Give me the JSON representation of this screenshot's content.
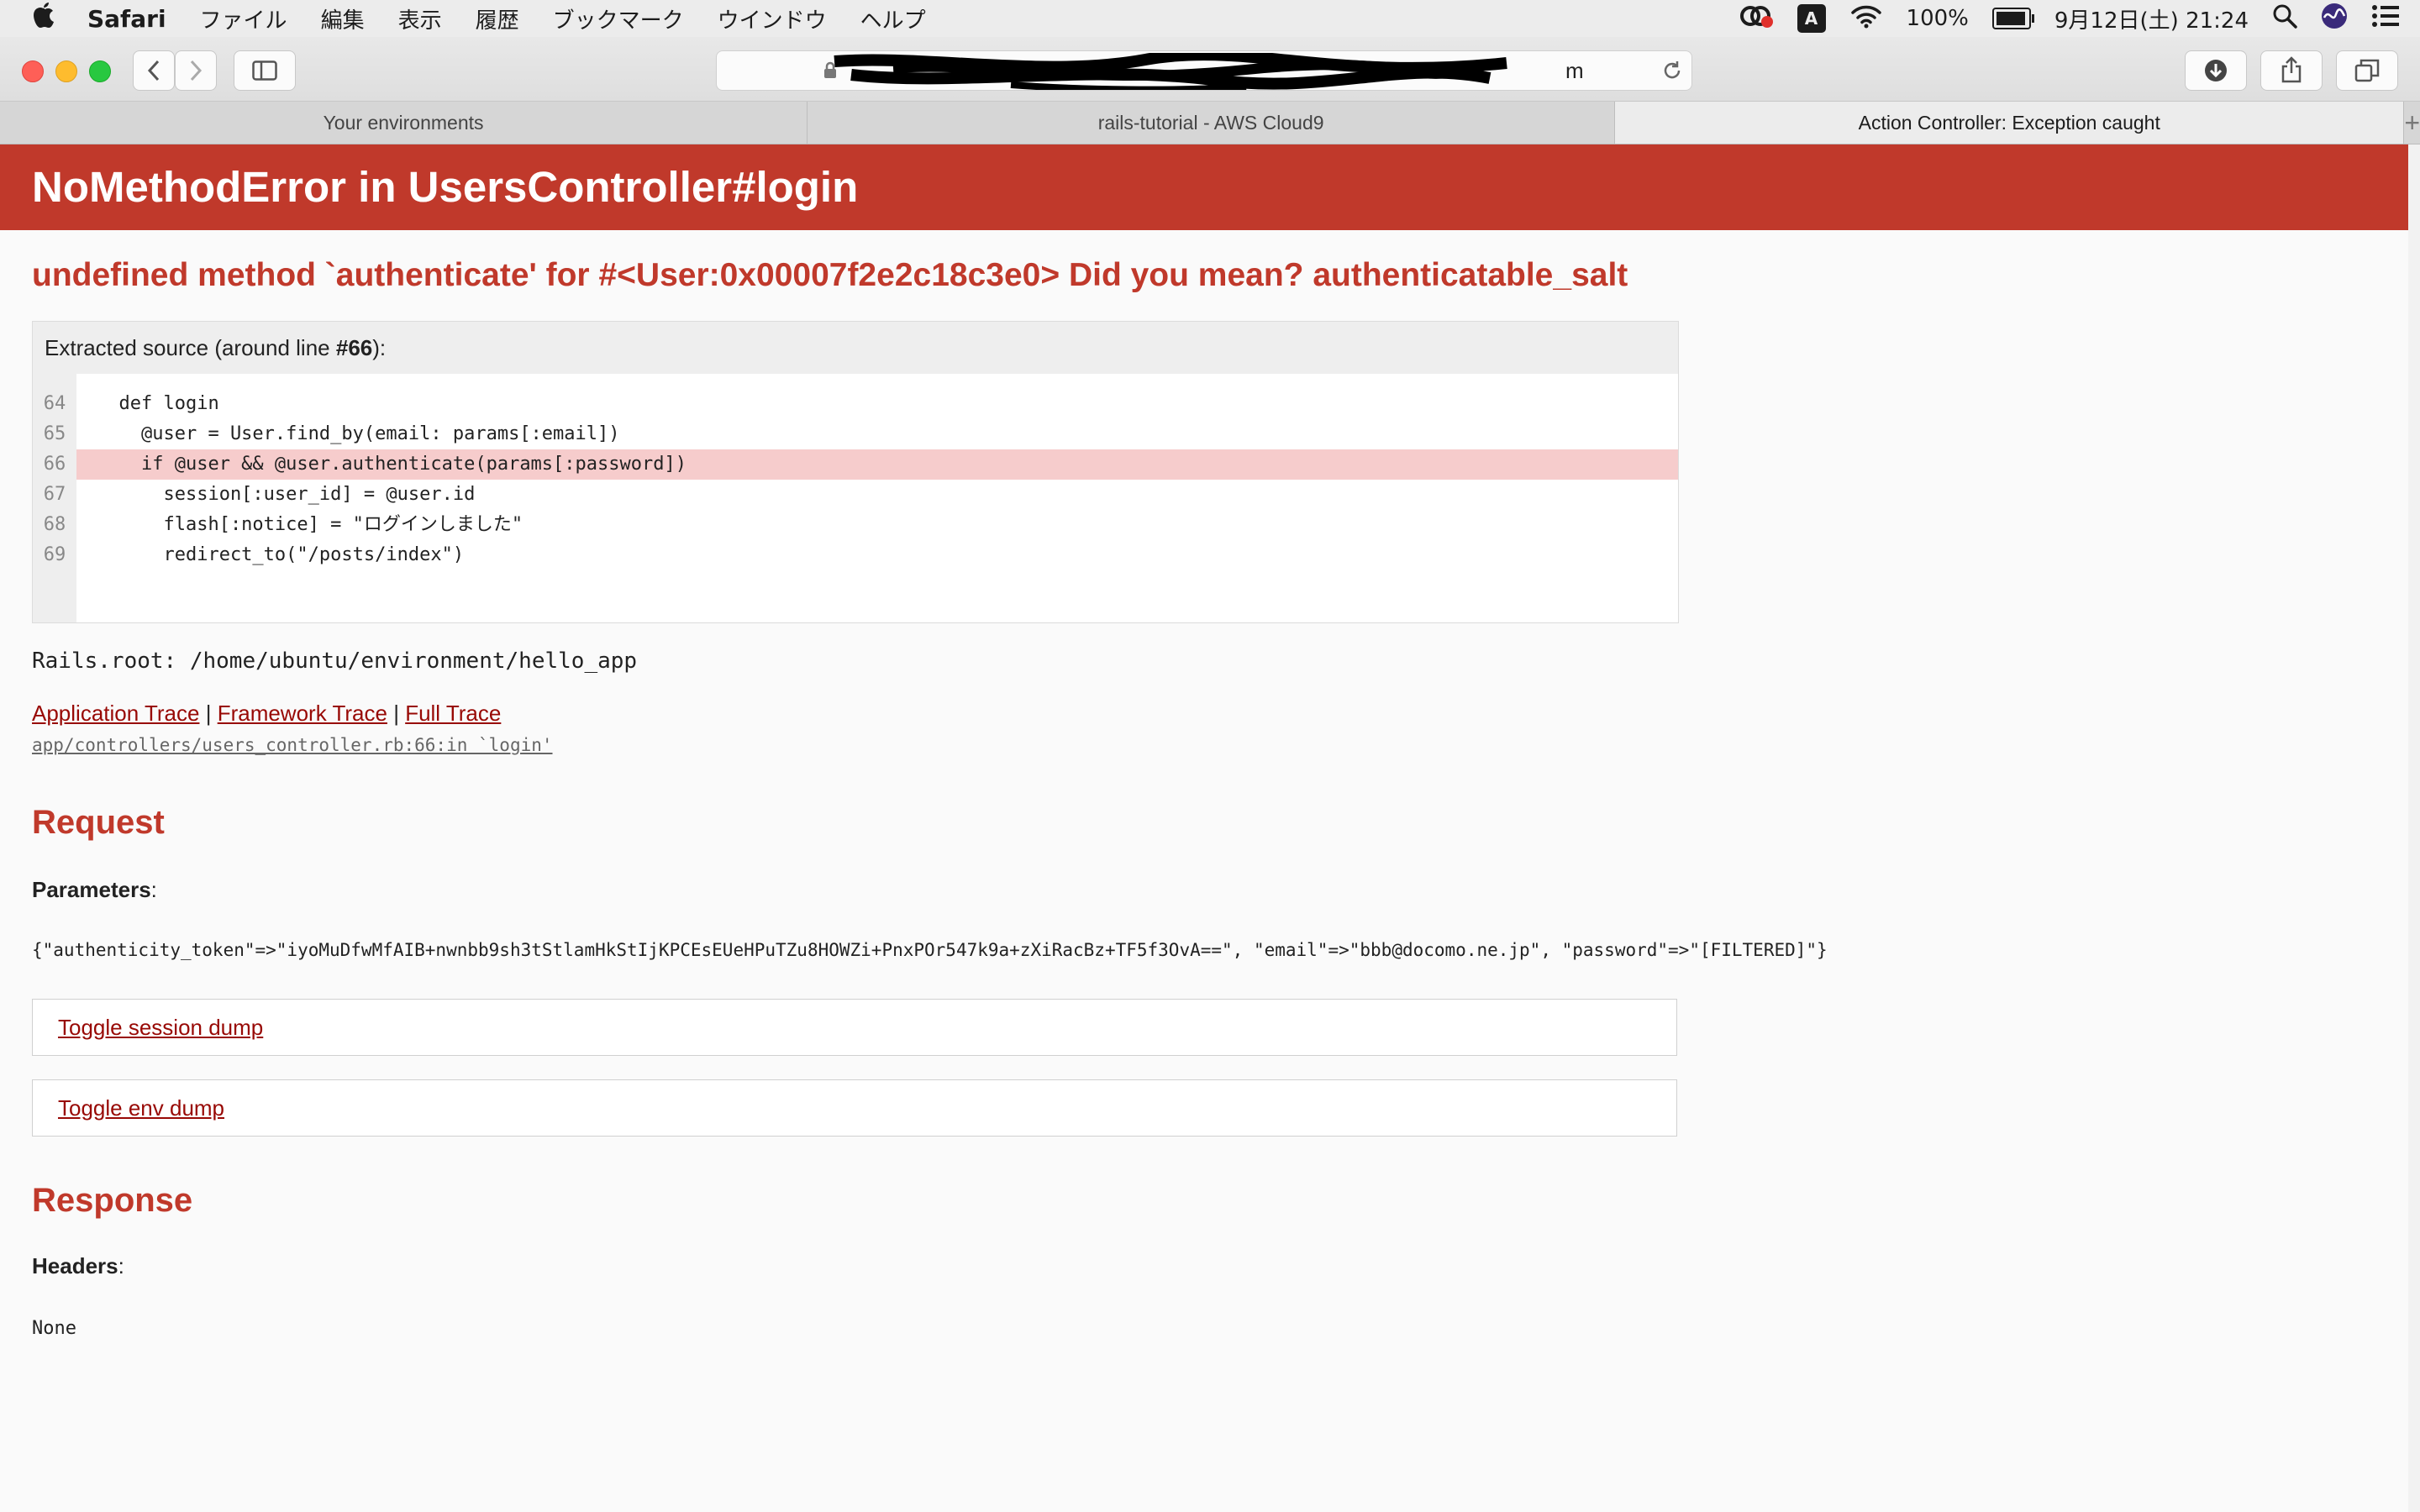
{
  "menubar": {
    "app_name": "Safari",
    "items": [
      "ファイル",
      "編集",
      "表示",
      "履歴",
      "ブックマーク",
      "ウインドウ",
      "ヘルプ"
    ],
    "input_indicator": "A",
    "battery": "100%",
    "datetime": "9月12日(土)  21:24"
  },
  "browser": {
    "url_visible": "m",
    "tabs": [
      {
        "label": "Your environments"
      },
      {
        "label": "rails-tutorial - AWS Cloud9"
      },
      {
        "label": "Action Controller: Exception caught"
      }
    ]
  },
  "page": {
    "title": "NoMethodError in UsersController#login",
    "message": "undefined method `authenticate' for #<User:0x00007f2e2c18c3e0> Did you mean?  authenticatable_salt",
    "source_header_prefix": "Extracted source (around line ",
    "source_header_line": "#66",
    "source_header_suffix": "):",
    "source_lines": [
      {
        "num": "64",
        "code": "  def login"
      },
      {
        "num": "65",
        "code": "    @user = User.find_by(email: params[:email])"
      },
      {
        "num": "66",
        "code": "    if @user && @user.authenticate(params[:password])"
      },
      {
        "num": "67",
        "code": "      session[:user_id] = @user.id"
      },
      {
        "num": "68",
        "code": "      flash[:notice] = \"ログインしました\""
      },
      {
        "num": "69",
        "code": "      redirect_to(\"/posts/index\")"
      }
    ],
    "rails_root": "Rails.root: /home/ubuntu/environment/hello_app",
    "trace_links": [
      "Application Trace",
      "Framework Trace",
      "Full Trace"
    ],
    "trace_separator": "|",
    "trace_line": "app/controllers/users_controller.rb:66:in `login'",
    "request_heading": "Request",
    "parameters_label": "Parameters",
    "parameters_value": "{\"authenticity_token\"=>\"iyoMuDfwMfAIB+nwnbb9sh3tStlamHkStIjKPCEsEUeHPuTZu8HOWZi+PnxPOr547k9a+zXiRacBz+TF5f3OvA==\", \"email\"=>\"bbb@docomo.ne.jp\", \"password\"=>\"[FILTERED]\"}",
    "toggle_session": "Toggle session dump",
    "toggle_env": "Toggle env dump",
    "response_heading": "Response",
    "headers_label": "Headers",
    "headers_value": "None"
  }
}
